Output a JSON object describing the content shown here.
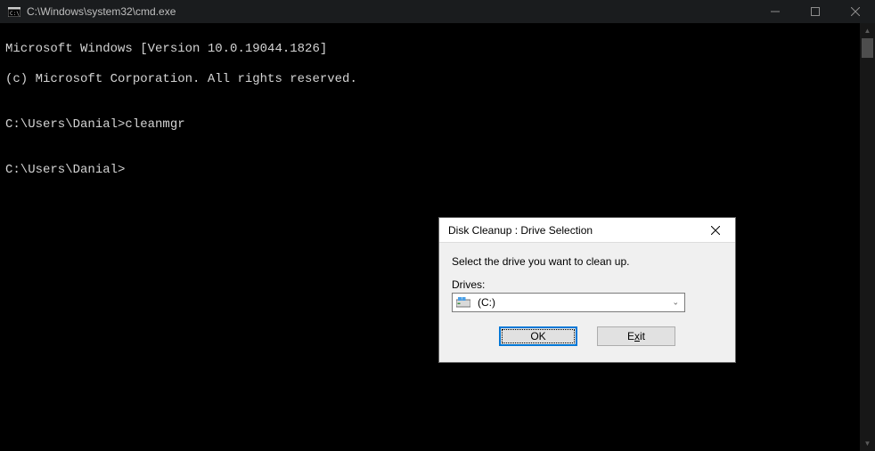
{
  "window": {
    "title": "C:\\Windows\\system32\\cmd.exe"
  },
  "terminal": {
    "line1": "Microsoft Windows [Version 10.0.19044.1826]",
    "line2": "(c) Microsoft Corporation. All rights reserved.",
    "line3": "",
    "line4": "C:\\Users\\Danial>cleanmgr",
    "line5": "",
    "line6": "C:\\Users\\Danial>"
  },
  "dialog": {
    "title": "Disk Cleanup : Drive Selection",
    "instruction": "Select the drive you want to clean up.",
    "drives_label": "Drives:",
    "selected_drive": " (C:)",
    "ok_label": "OK",
    "exit_prefix": "E",
    "exit_suffix": "it",
    "exit_underline": "x"
  }
}
